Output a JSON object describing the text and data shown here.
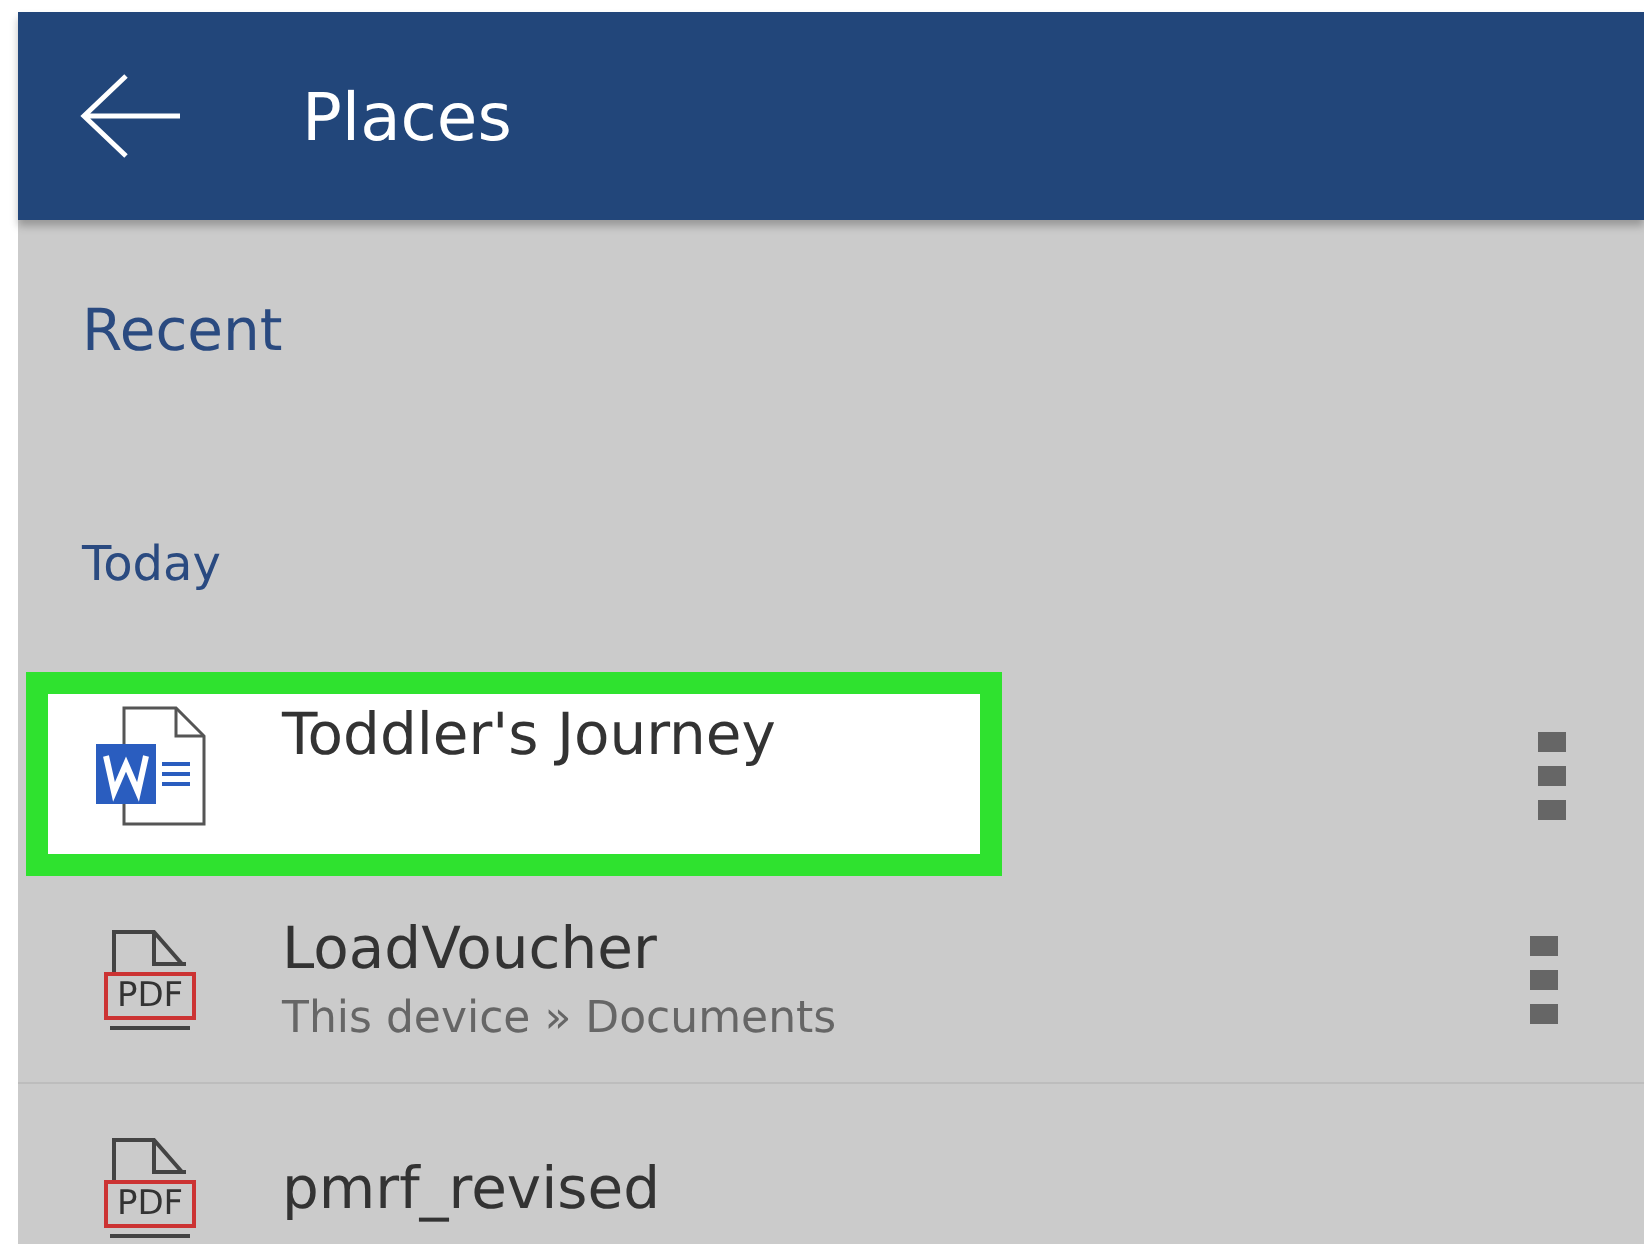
{
  "header": {
    "title": "Places"
  },
  "section": "Recent",
  "group": "Today",
  "files": [
    {
      "kind": "word",
      "name": "Toddler's Journey",
      "highlighted": true
    },
    {
      "kind": "pdf",
      "name": "LoadVoucher",
      "highlighted": false,
      "location": "This device » Documents",
      "icon_label": "PDF"
    },
    {
      "kind": "pdf",
      "name": "pmrf_revised",
      "highlighted": false,
      "icon_label": "PDF"
    }
  ]
}
